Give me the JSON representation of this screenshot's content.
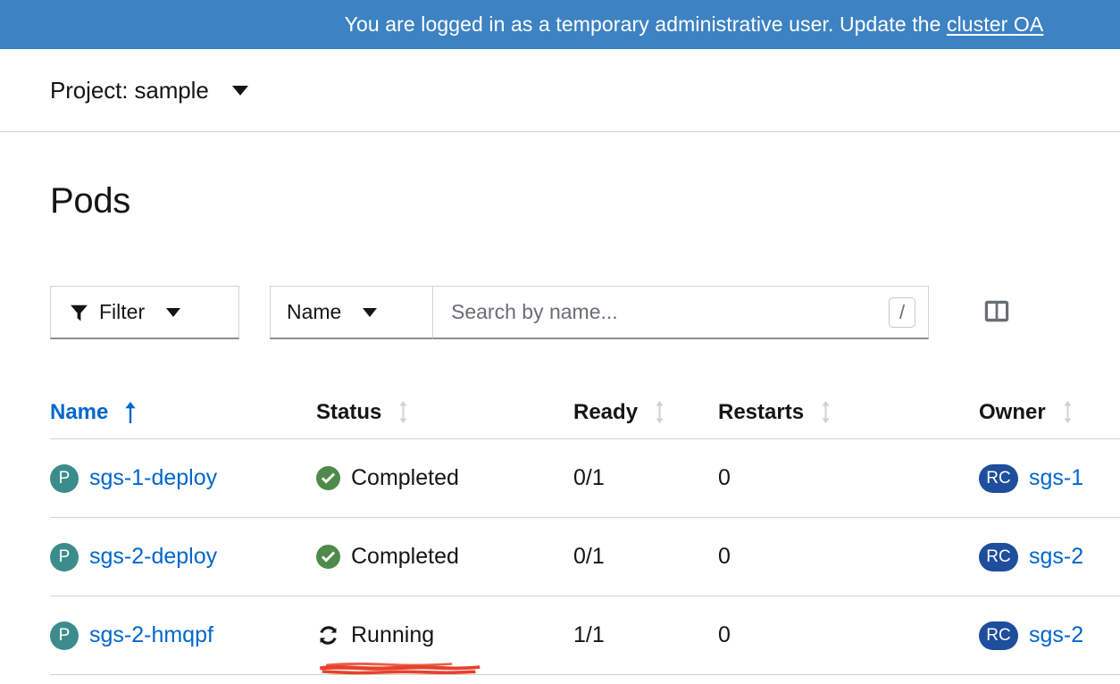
{
  "banner": {
    "message": "You are logged in as a temporary administrative user. Update the ",
    "link_text": "cluster OA"
  },
  "project_bar": {
    "label": "Project: sample",
    "caret_icon": "caret-down-icon"
  },
  "page": {
    "title": "Pods"
  },
  "toolbar": {
    "filter_label": "Filter",
    "filter_icon": "funnel-icon",
    "attribute_label": "Name",
    "search_placeholder": "Search by name...",
    "search_value": "",
    "search_shortcut": "/",
    "columns_icon": "columns-icon"
  },
  "table": {
    "columns": [
      {
        "label": "Name",
        "sort": "asc",
        "active": true
      },
      {
        "label": "Status",
        "sort": "none",
        "active": false
      },
      {
        "label": "Ready",
        "sort": "none",
        "active": false
      },
      {
        "label": "Restarts",
        "sort": "none",
        "active": false
      },
      {
        "label": "Owner",
        "sort": "none",
        "active": false
      }
    ],
    "rows": [
      {
        "badge": "P",
        "name": "sgs-1-deploy",
        "status": "Completed",
        "status_icon": "check-circle-icon",
        "ready": "0/1",
        "restarts": "0",
        "owner_badge": "RC",
        "owner": "sgs-1",
        "annotated": false
      },
      {
        "badge": "P",
        "name": "sgs-2-deploy",
        "status": "Completed",
        "status_icon": "check-circle-icon",
        "ready": "0/1",
        "restarts": "0",
        "owner_badge": "RC",
        "owner": "sgs-2",
        "annotated": false
      },
      {
        "badge": "P",
        "name": "sgs-2-hmqpf",
        "status": "Running",
        "status_icon": "sync-icon",
        "ready": "1/1",
        "restarts": "0",
        "owner_badge": "RC",
        "owner": "sgs-2",
        "annotated": true
      }
    ]
  },
  "colors": {
    "banner_blue": "#3d82c2",
    "link_blue": "#0066cc",
    "pod_badge_teal": "#3c8c8c",
    "owner_badge_navy": "#1e4e9c",
    "success_green": "#3e8635",
    "annotation_red": "#e8412a"
  }
}
